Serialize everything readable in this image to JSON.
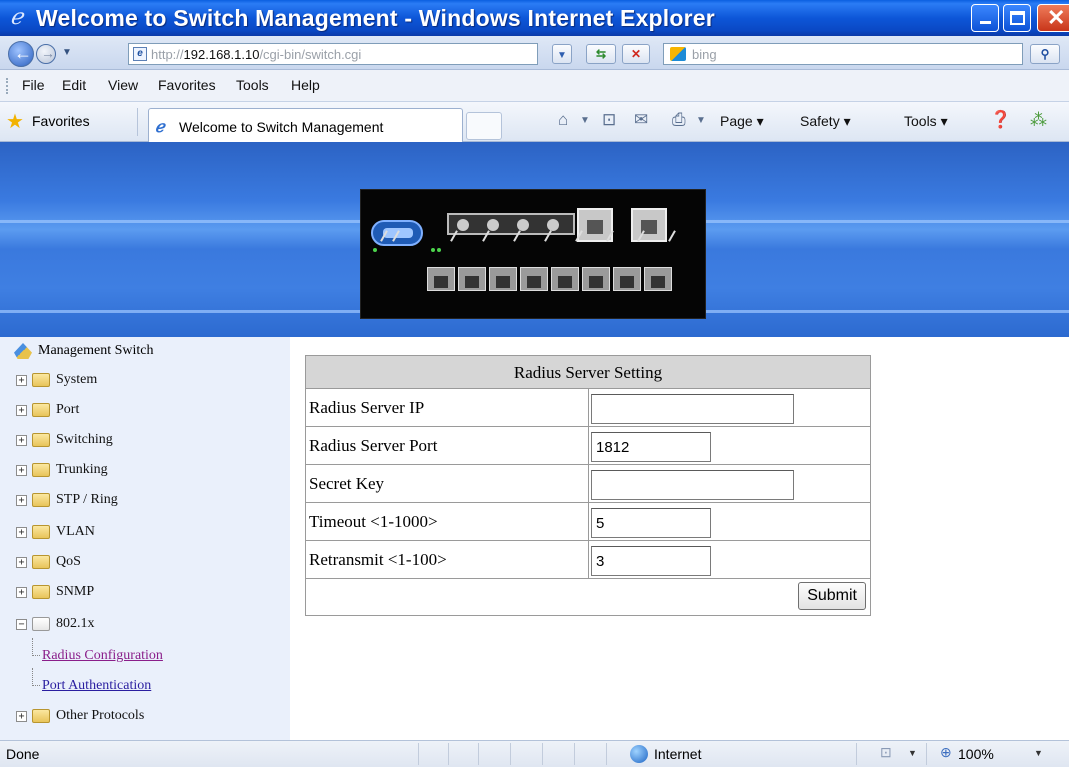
{
  "window": {
    "title": "Welcome to Switch Management - Windows Internet Explorer"
  },
  "addressbar": {
    "url_prefix": "http://",
    "url_host": "192.168.1.10",
    "url_path": "/cgi-bin/switch.cgi",
    "search_placeholder": "bing"
  },
  "menubar": {
    "items": [
      "File",
      "Edit",
      "View",
      "Favorites",
      "Tools",
      "Help"
    ]
  },
  "favbar": {
    "favorites_label": "Favorites",
    "tab_label": "Welcome to Switch Management",
    "page_label": "Page",
    "safety_label": "Safety",
    "tools_label": "Tools"
  },
  "sidebar": {
    "root_label": "Management Switch",
    "nodes": [
      {
        "label": "System",
        "expanded": false
      },
      {
        "label": "Port",
        "expanded": false
      },
      {
        "label": "Switching",
        "expanded": false
      },
      {
        "label": "Trunking",
        "expanded": false
      },
      {
        "label": "STP / Ring",
        "expanded": false
      },
      {
        "label": "VLAN",
        "expanded": false
      },
      {
        "label": "QoS",
        "expanded": false
      },
      {
        "label": "SNMP",
        "expanded": false
      },
      {
        "label": "802.1x",
        "expanded": true
      },
      {
        "label": "Other Protocols",
        "expanded": false
      }
    ],
    "children_8021x": [
      {
        "label": "Radius Configuration",
        "visited": true
      },
      {
        "label": "Port Authentication",
        "visited": false
      }
    ]
  },
  "form": {
    "title": "Radius Server Setting",
    "fields": [
      {
        "label": "Radius Server IP",
        "value": ""
      },
      {
        "label": "Radius Server Port",
        "value": "1812"
      },
      {
        "label": "Secret Key",
        "value": ""
      },
      {
        "label": "Timeout <1-1000>",
        "value": "5"
      },
      {
        "label": "Retransmit <1-100>",
        "value": "3"
      }
    ],
    "submit_label": "Submit"
  },
  "statusbar": {
    "status_text": "Done",
    "zone_text": "Internet",
    "zoom_text": "100%"
  },
  "icons": {
    "back": "back-arrow-icon",
    "forward": "forward-arrow-icon",
    "refresh": "refresh-icon",
    "stop": "stop-icon",
    "search": "search-icon",
    "home": "home-icon",
    "rss": "rss-feed-icon",
    "mail": "read-mail-icon",
    "print": "print-icon",
    "help": "help-icon",
    "research": "research-icon"
  },
  "colors": {
    "titlebar_blue": "#0d56d8",
    "sidebar_bg": "#eaf0fb",
    "panel_header_bg": "#d6d6d6",
    "link_visited": "#8a1e8a",
    "link": "#2a1ea0"
  }
}
